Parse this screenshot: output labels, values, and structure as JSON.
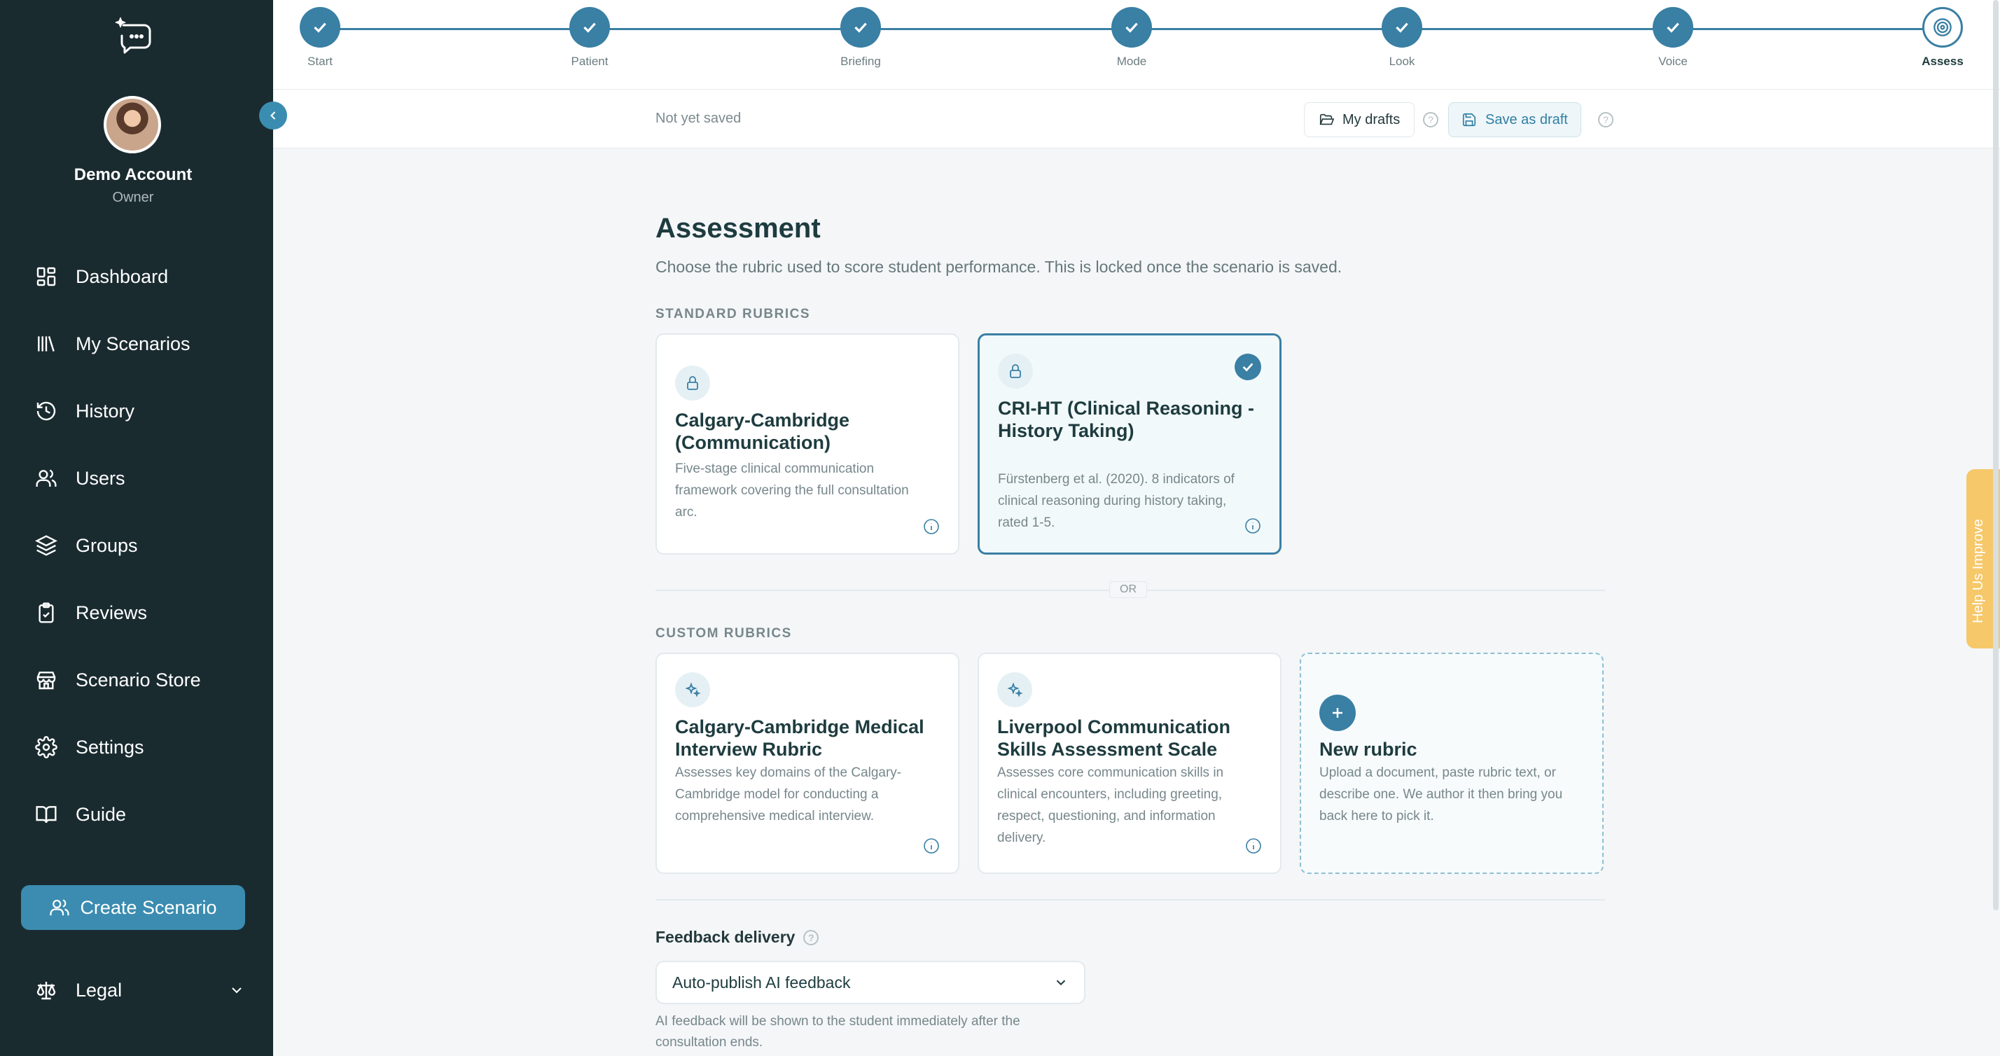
{
  "account": {
    "name": "Demo Account",
    "role": "Owner"
  },
  "nav": [
    {
      "label": "Dashboard",
      "icon": "dashboard-icon"
    },
    {
      "label": "My Scenarios",
      "icon": "library-icon"
    },
    {
      "label": "History",
      "icon": "history-icon"
    },
    {
      "label": "Users",
      "icon": "users-icon"
    },
    {
      "label": "Groups",
      "icon": "layers-icon"
    },
    {
      "label": "Reviews",
      "icon": "clipboard-check-icon"
    },
    {
      "label": "Scenario Store",
      "icon": "store-icon"
    },
    {
      "label": "Settings",
      "icon": "gear-icon"
    },
    {
      "label": "Guide",
      "icon": "book-icon"
    }
  ],
  "create_button": "Create Scenario",
  "legal": "Legal",
  "steps": [
    {
      "label": "Start",
      "done": true
    },
    {
      "label": "Patient",
      "done": true
    },
    {
      "label": "Briefing",
      "done": true
    },
    {
      "label": "Mode",
      "done": true
    },
    {
      "label": "Look",
      "done": true
    },
    {
      "label": "Voice",
      "done": true
    },
    {
      "label": "Assess",
      "done": false,
      "active": true
    }
  ],
  "savebar": {
    "status": "Not yet saved",
    "drafts": "My drafts",
    "save": "Save as draft"
  },
  "page": {
    "title": "Assessment",
    "subtitle": "Choose the rubric used to score student performance. This is locked once the scenario is saved.",
    "standard_label": "STANDARD RUBRICS",
    "or": "OR",
    "custom_label": "CUSTOM RUBRICS"
  },
  "standard_rubrics": [
    {
      "title": "Calgary-Cambridge (Communication)",
      "desc": "Five-stage clinical communication framework covering the full consultation arc.",
      "selected": false
    },
    {
      "title": "CRI-HT (Clinical Reasoning - History Taking)",
      "desc": "Fürstenberg et al. (2020). 8 indicators of clinical reasoning during history taking, rated 1-5.",
      "selected": true
    }
  ],
  "custom_rubrics": [
    {
      "title": "Calgary-Cambridge Medical Interview Rubric",
      "desc": "Assesses key domains of the Calgary-Cambridge model for conducting a comprehensive medical interview."
    },
    {
      "title": "Liverpool Communication Skills Assessment Scale",
      "desc": "Assesses core communication skills in clinical encounters, including greeting, respect, questioning, and information delivery."
    }
  ],
  "new_rubric": {
    "title": "New rubric",
    "desc": "Upload a document, paste rubric text, or describe one. We author it then bring you back here to pick it."
  },
  "feedback": {
    "label": "Feedback delivery",
    "value": "Auto-publish AI feedback",
    "note": "AI feedback will be shown to the student immediately after the consultation ends."
  },
  "help_tab": "Help Us Improve",
  "colors": {
    "sidebar": "#1a2b30",
    "accent": "#3a7fa4",
    "button": "#3b8cb0",
    "help_tab": "#f6c86a"
  }
}
